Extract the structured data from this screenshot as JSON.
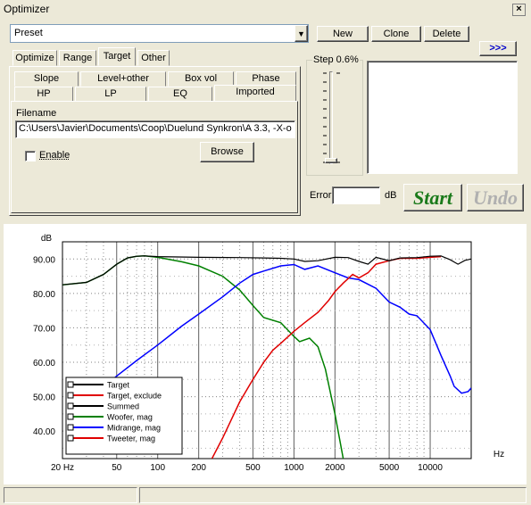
{
  "window": {
    "title": "Optimizer",
    "close_glyph": "×"
  },
  "preset": {
    "value": "Preset",
    "arrow": "▼"
  },
  "buttons": {
    "new": "New",
    "clone": "Clone",
    "delete": "Delete",
    "more": ">>>",
    "browse": "Browse",
    "start": "Start",
    "undo": "Undo"
  },
  "main_tabs": [
    "Optimize",
    "Range",
    "Target",
    "Other"
  ],
  "sub_tabs_row1": [
    "Slope",
    "Level+other",
    "Box vol",
    "Phase"
  ],
  "sub_tabs_row2": [
    "HP",
    "LP",
    "EQ",
    "Imported"
  ],
  "filename": {
    "label": "Filename",
    "value": "C:\\Users\\Javier\\Documents\\Coop\\Duelund Synkron\\A 3.3, -X-o"
  },
  "enable": {
    "label": "Enable",
    "checked": false
  },
  "step": {
    "label": "Step 0.6%"
  },
  "error": {
    "label": "Error",
    "value": "",
    "unit": "dB"
  },
  "colors": {
    "start": "#1a7a1a",
    "undo": "#b0b0b0",
    "more": "#0000cc"
  },
  "chart_data": {
    "type": "line",
    "xscale": "log",
    "xlabel": "Hz",
    "ylabel": "dB",
    "xlim": [
      20,
      20000
    ],
    "ylim": [
      32,
      95
    ],
    "xticks": [
      {
        "v": 20,
        "t": "20 Hz"
      },
      {
        "v": 50,
        "t": "50"
      },
      {
        "v": 100,
        "t": "100"
      },
      {
        "v": 200,
        "t": "200"
      },
      {
        "v": 500,
        "t": "500"
      },
      {
        "v": 1000,
        "t": "1000"
      },
      {
        "v": 2000,
        "t": "2000"
      },
      {
        "v": 5000,
        "t": "5000"
      },
      {
        "v": 10000,
        "t": "10000"
      }
    ],
    "yticks": [
      {
        "v": 90,
        "t": "90.00"
      },
      {
        "v": 80,
        "t": "80.00"
      },
      {
        "v": 70,
        "t": "70.00"
      },
      {
        "v": 60,
        "t": "60.00"
      },
      {
        "v": 50,
        "t": "50.00"
      },
      {
        "v": 40,
        "t": "40.00"
      }
    ],
    "legend": "bottom-left",
    "series": [
      {
        "name": "Target",
        "color": "#000000",
        "points": []
      },
      {
        "name": "Target, exclude",
        "color": "#e00000",
        "points": []
      },
      {
        "name": "Summed",
        "color": "#000000",
        "points": [
          [
            20,
            82.5
          ],
          [
            30,
            83.2
          ],
          [
            40,
            85.5
          ],
          [
            50,
            88.5
          ],
          [
            60,
            90.3
          ],
          [
            70,
            90.8
          ],
          [
            80,
            90.9
          ],
          [
            100,
            90.7
          ],
          [
            200,
            90.5
          ],
          [
            400,
            90.4
          ],
          [
            600,
            90.3
          ],
          [
            800,
            90.2
          ],
          [
            1000,
            90.0
          ],
          [
            1200,
            89.3
          ],
          [
            1500,
            89.5
          ],
          [
            2000,
            90.5
          ],
          [
            2500,
            90.4
          ],
          [
            3000,
            89.3
          ],
          [
            3500,
            88.5
          ],
          [
            4000,
            90.5
          ],
          [
            5000,
            89.5
          ],
          [
            6000,
            90.3
          ],
          [
            8000,
            90.4
          ],
          [
            10000,
            90.8
          ],
          [
            12000,
            90.9
          ],
          [
            14000,
            89.8
          ],
          [
            16000,
            88.5
          ],
          [
            18000,
            89.6
          ],
          [
            20000,
            90.0
          ]
        ]
      },
      {
        "name": "Woofer, mag",
        "color": "#008000",
        "points": [
          [
            20,
            82.5
          ],
          [
            30,
            83.2
          ],
          [
            40,
            85.5
          ],
          [
            50,
            88.5
          ],
          [
            60,
            90.3
          ],
          [
            70,
            90.8
          ],
          [
            80,
            90.9
          ],
          [
            100,
            90.5
          ],
          [
            150,
            89.2
          ],
          [
            200,
            88.0
          ],
          [
            300,
            85.0
          ],
          [
            400,
            81.0
          ],
          [
            500,
            76.5
          ],
          [
            600,
            73.0
          ],
          [
            800,
            71.5
          ],
          [
            1000,
            67.5
          ],
          [
            1100,
            66.0
          ],
          [
            1300,
            67.0
          ],
          [
            1500,
            64.5
          ],
          [
            1700,
            58.0
          ],
          [
            2000,
            45.0
          ],
          [
            2300,
            32.0
          ]
        ]
      },
      {
        "name": "Midrange, mag",
        "color": "#0000ff",
        "points": [
          [
            38,
            52.0
          ],
          [
            50,
            56.0
          ],
          [
            70,
            60.5
          ],
          [
            100,
            65.0
          ],
          [
            150,
            70.5
          ],
          [
            200,
            74.0
          ],
          [
            300,
            79.0
          ],
          [
            400,
            83.0
          ],
          [
            500,
            85.5
          ],
          [
            600,
            86.5
          ],
          [
            800,
            88.0
          ],
          [
            1000,
            88.4
          ],
          [
            1200,
            87.0
          ],
          [
            1500,
            88.0
          ],
          [
            2000,
            86.0
          ],
          [
            2500,
            84.5
          ],
          [
            3000,
            84.0
          ],
          [
            4000,
            81.5
          ],
          [
            5000,
            77.5
          ],
          [
            6000,
            76.0
          ],
          [
            7000,
            74.0
          ],
          [
            8000,
            73.5
          ],
          [
            10000,
            69.5
          ],
          [
            12000,
            62.0
          ],
          [
            14000,
            56.0
          ],
          [
            15000,
            53.0
          ],
          [
            17000,
            51.0
          ],
          [
            19000,
            51.5
          ],
          [
            20000,
            52.5
          ]
        ]
      },
      {
        "name": "Tweeter, mag",
        "color": "#e00000",
        "points": [
          [
            250,
            32.0
          ],
          [
            300,
            38.0
          ],
          [
            400,
            48.5
          ],
          [
            500,
            55.0
          ],
          [
            600,
            60.0
          ],
          [
            700,
            63.5
          ],
          [
            800,
            65.5
          ],
          [
            1000,
            69.0
          ],
          [
            1200,
            71.5
          ],
          [
            1500,
            74.5
          ],
          [
            1800,
            78.0
          ],
          [
            2000,
            80.5
          ],
          [
            2300,
            83.0
          ],
          [
            2700,
            85.5
          ],
          [
            3000,
            84.5
          ],
          [
            3500,
            86.0
          ],
          [
            4000,
            88.5
          ],
          [
            5000,
            89.5
          ],
          [
            6000,
            90.2
          ],
          [
            8000,
            90.2
          ],
          [
            10000,
            90.5
          ],
          [
            12000,
            90.7
          ]
        ]
      }
    ]
  }
}
